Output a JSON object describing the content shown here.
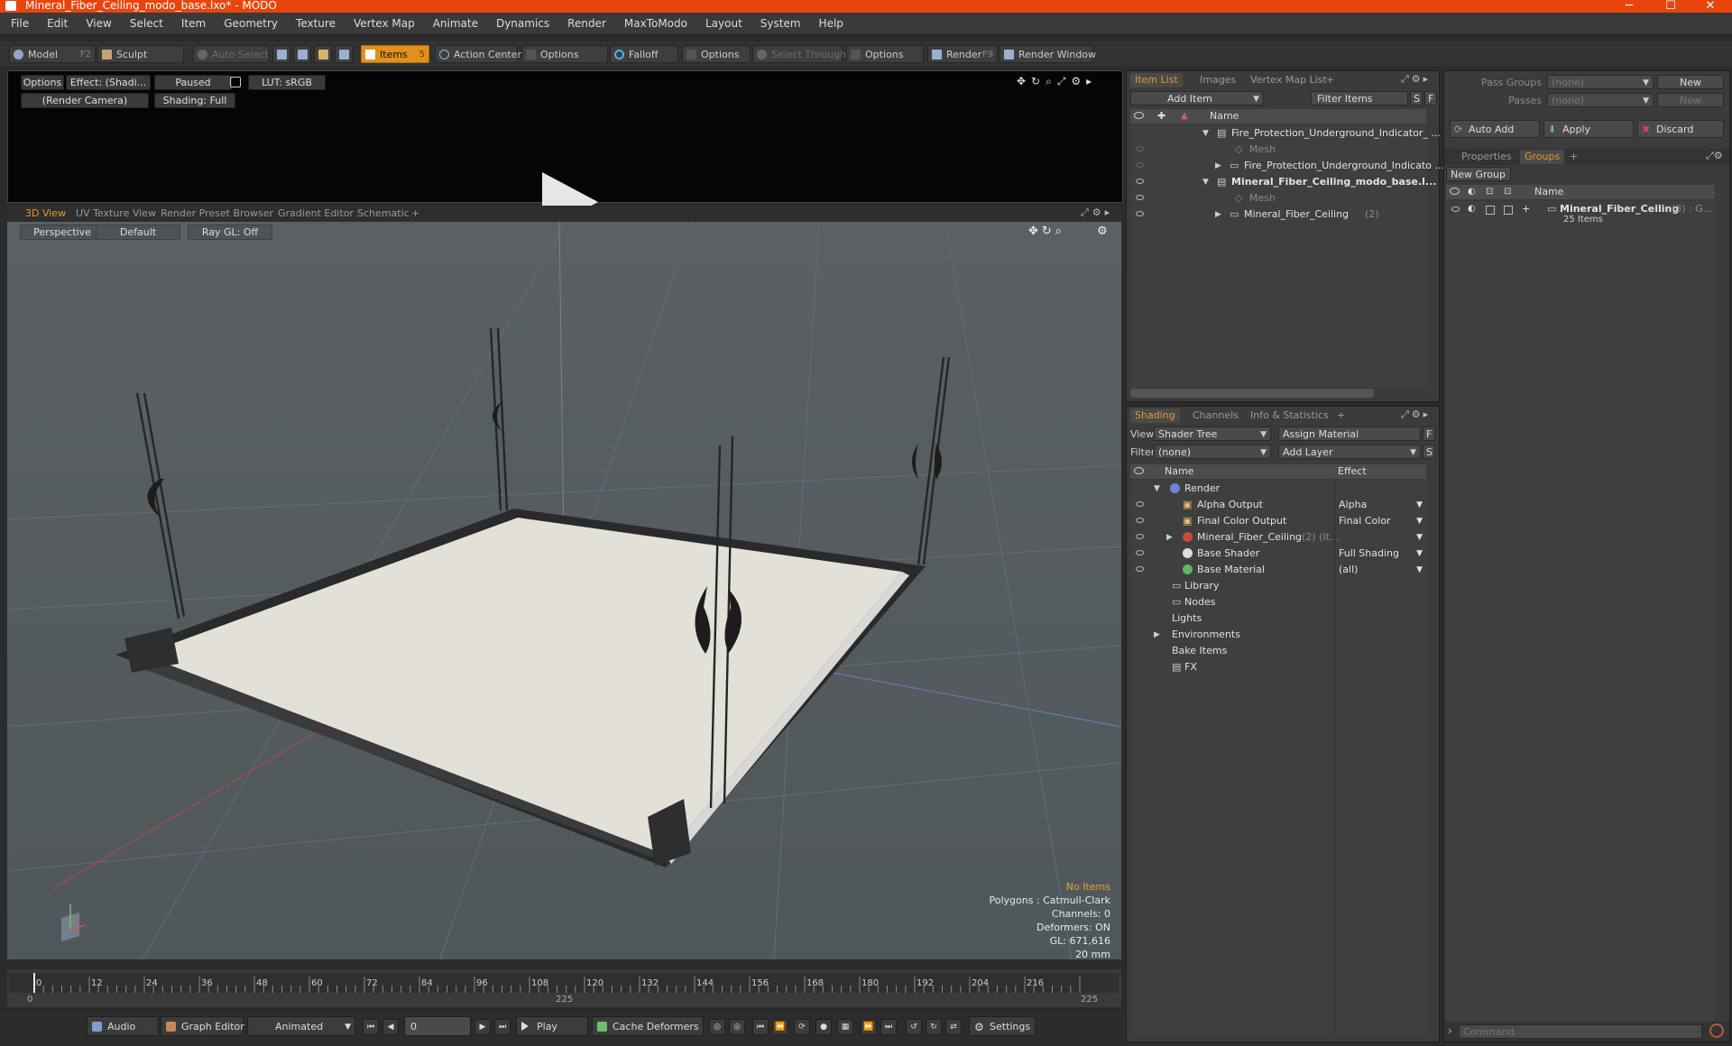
{
  "window": {
    "title": "Mineral_Fiber_Ceiling_modo_base.lxo* - MODO",
    "minimize": "─",
    "maximize": "☐",
    "close": "✕"
  },
  "menu": [
    "File",
    "Edit",
    "View",
    "Select",
    "Item",
    "Geometry",
    "Texture",
    "Vertex Map",
    "Animate",
    "Dynamics",
    "Render",
    "MaxToModo",
    "Layout",
    "System",
    "Help"
  ],
  "toolbar": {
    "model": "Model",
    "model_key": "F2",
    "sculpt": "Sculpt",
    "auto_select": "Auto Select",
    "items": "Items",
    "items_key": "5",
    "action_center": "Action Center",
    "options1": "Options",
    "falloff": "Falloff",
    "options2": "Options",
    "select_through": "Select Through",
    "options3": "Options",
    "render": "Render",
    "render_key": "F9",
    "render_window": "Render Window"
  },
  "preview": {
    "options": "Options",
    "effect": "Effect: (Shadi...",
    "paused": "Paused",
    "lut": "LUT: sRGB",
    "camera": "(Render Camera)",
    "shading": "Shading: Full"
  },
  "viewport_tabs": [
    "3D View",
    "UV Texture View",
    "Render Preset Browser",
    "Gradient Editor",
    "Schematic",
    "+"
  ],
  "viewport": {
    "perspective": "Perspective",
    "default": "Default",
    "raygl": "Ray GL: Off",
    "info": [
      "No Items",
      "Polygons : Catmull-Clark",
      "Channels: 0",
      "Deformers: ON",
      "GL: 671,616",
      "20 mm"
    ]
  },
  "timeline": {
    "ticks": [
      "0",
      "12",
      "24",
      "36",
      "48",
      "60",
      "72",
      "84",
      "96",
      "108",
      "120",
      "132",
      "144",
      "156",
      "168",
      "180",
      "192",
      "204",
      "216"
    ],
    "start": "0",
    "mid": "225",
    "end": "225"
  },
  "bottom": {
    "audio": "Audio",
    "graph_editor": "Graph Editor",
    "animated": "Animated",
    "frame": "0",
    "play": "Play",
    "cache": "Cache Deformers",
    "settings": "Settings"
  },
  "item_list": {
    "tabs": [
      "Item List",
      "Images",
      "Vertex Map List",
      "+"
    ],
    "add_item": "Add Item",
    "filter": "Filter Items",
    "s": "S",
    "f": "F",
    "col_name": "Name",
    "rows": [
      {
        "label": "Fire_Protection_Underground_Indicator_ ...",
        "dim": false
      },
      {
        "label": "Mesh",
        "dim": true
      },
      {
        "label": "Fire_Protection_Underground_Indicato ...",
        "dim": false
      },
      {
        "label": "Mineral_Fiber_Ceiling_modo_base.l...",
        "dim": false
      },
      {
        "label": "Mesh",
        "dim": true
      },
      {
        "label": "Mineral_Fiber_Ceiling",
        "count": "(2)",
        "dim": false
      }
    ]
  },
  "shading": {
    "tabs": [
      "Shading",
      "Channels",
      "Info & Statistics",
      "+"
    ],
    "view_label": "View",
    "view_value": "Shader Tree",
    "assign": "Assign Material",
    "f": "F",
    "filter_label": "Filter",
    "filter_value": "(none)",
    "add_layer": "Add Layer",
    "s": "S",
    "col_name": "Name",
    "col_effect": "Effect",
    "rows": [
      {
        "label": "Render",
        "effect": ""
      },
      {
        "label": "Alpha Output",
        "effect": "Alpha"
      },
      {
        "label": "Final Color Output",
        "effect": "Final Color"
      },
      {
        "label": "Mineral_Fiber_Ceiling",
        "suffix": "(2) (It...",
        "effect": ""
      },
      {
        "label": "Base Shader",
        "effect": "Full Shading"
      },
      {
        "label": "Base Material",
        "effect": "(all)"
      },
      {
        "label": "Library",
        "effect": ""
      },
      {
        "label": "Nodes",
        "effect": ""
      },
      {
        "label": "Lights",
        "effect": ""
      },
      {
        "label": "Environments",
        "effect": ""
      },
      {
        "label": "Bake Items",
        "effect": ""
      },
      {
        "label": "FX",
        "effect": ""
      }
    ]
  },
  "groups": {
    "pass_groups_label": "Pass Groups",
    "pass_groups_value": "(none)",
    "new1": "New",
    "passes_label": "Passes",
    "passes_value": "(none)",
    "new2": "New",
    "auto_add": "Auto Add",
    "apply": "Apply",
    "discard": "Discard",
    "tabs": [
      "Properties",
      "Groups",
      "+"
    ],
    "new_group": "New Group",
    "col_name": "Name",
    "group_name": "Mineral_Fiber_Ceiling",
    "group_suffix": "(3) : G...",
    "group_items": "25 Items",
    "command_placeholder": "Command"
  }
}
